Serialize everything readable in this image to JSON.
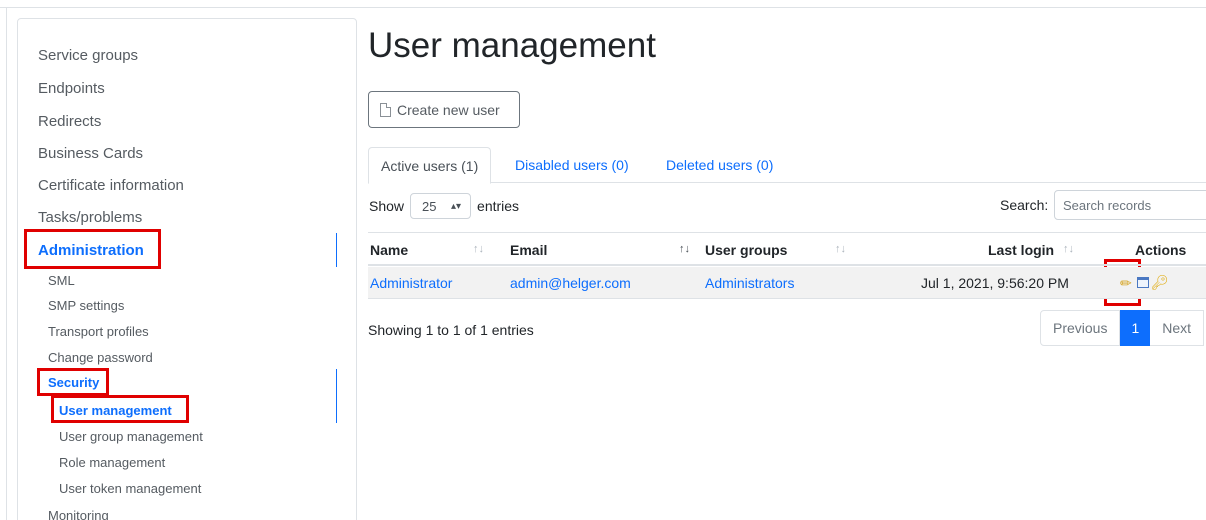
{
  "sidebar": {
    "items": [
      {
        "label": "Service groups"
      },
      {
        "label": "Endpoints"
      },
      {
        "label": "Redirects"
      },
      {
        "label": "Business Cards"
      },
      {
        "label": "Certificate information"
      },
      {
        "label": "Tasks/problems"
      },
      {
        "label": "Administration"
      },
      {
        "label": "SML"
      },
      {
        "label": "SMP settings"
      },
      {
        "label": "Transport profiles"
      },
      {
        "label": "Change password"
      },
      {
        "label": "Security"
      },
      {
        "label": "User management"
      },
      {
        "label": "User group management"
      },
      {
        "label": "Role management"
      },
      {
        "label": "User token management"
      },
      {
        "label": "Monitoring"
      }
    ]
  },
  "main": {
    "title": "User management",
    "create_button": "Create new user",
    "tabs": [
      {
        "label": "Active users (1)"
      },
      {
        "label": "Disabled users (0)"
      },
      {
        "label": "Deleted users (0)"
      }
    ],
    "show_label": "Show",
    "entries_value": "25",
    "entries_label": "entries",
    "search_label": "Search:",
    "search_placeholder": "Search records",
    "columns": [
      "Name",
      "Email",
      "User groups",
      "Last login",
      "Actions"
    ],
    "rows": [
      {
        "name": "Administrator",
        "email": "admin@helger.com",
        "groups": "Administrators",
        "last_login": "Jul 1, 2021, 9:56:20 PM"
      }
    ],
    "info": "Showing 1 to 1 of 1 entries",
    "pagination": {
      "previous": "Previous",
      "current": "1",
      "next": "Next"
    }
  },
  "icons": [
    "document-icon",
    "pencil-icon",
    "window-icon",
    "key-icon",
    "sort-icon",
    "select-arrows-icon"
  ],
  "colors": {
    "accent": "#0d6efd",
    "highlight": "#e00000"
  }
}
